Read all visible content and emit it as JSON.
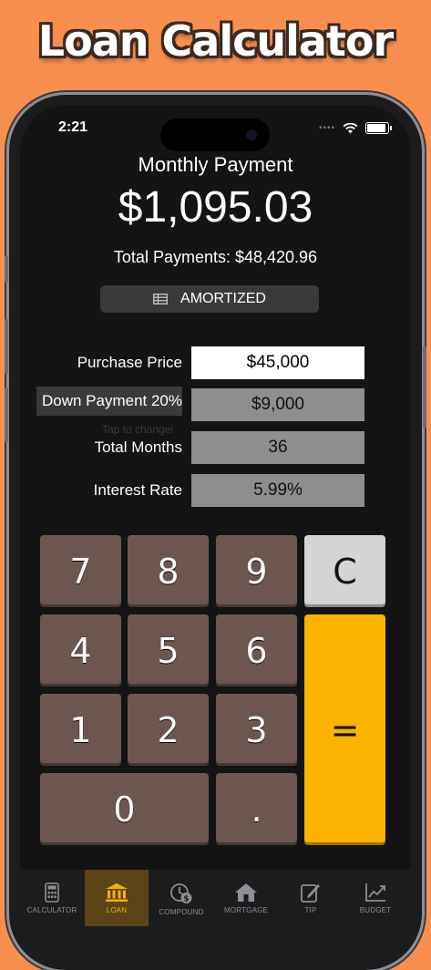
{
  "banner": {
    "title": "Loan Calculator"
  },
  "status": {
    "time": "2:21",
    "signal_dots": "••••"
  },
  "result": {
    "label": "Monthly Payment",
    "value": "$1,095.03",
    "total": "Total Payments: $48,420.96"
  },
  "amortized_button": {
    "label": "AMORTIZED"
  },
  "fields": [
    {
      "label": "Purchase Price",
      "value": "$45,000"
    },
    {
      "label": "Down Payment 20%",
      "value": "$9,000"
    },
    {
      "label": "Total Months",
      "value": "36"
    },
    {
      "label": "Interest Rate",
      "value": "5.99%"
    }
  ],
  "hint": "Tap to change!",
  "keypad": {
    "k7": "7",
    "k8": "8",
    "k9": "9",
    "clear": "C",
    "k4": "4",
    "k5": "5",
    "k6": "6",
    "k1": "1",
    "k2": "2",
    "k3": "3",
    "equals": "=",
    "k0": "0",
    "dot": "."
  },
  "tabs": [
    {
      "label": "CALCULATOR",
      "icon": "calculator-icon"
    },
    {
      "label": "LOAN",
      "icon": "bank-icon"
    },
    {
      "label": "COMPOUND",
      "icon": "compound-icon"
    },
    {
      "label": "MORTGAGE",
      "icon": "house-icon"
    },
    {
      "label": "TIP",
      "icon": "edit-icon"
    },
    {
      "label": "BUDGET",
      "icon": "chart-icon"
    }
  ],
  "colors": {
    "background": "#f98f4f",
    "number_key": "#6e5650",
    "equals_key": "#fbb300",
    "clear_key": "#d4d4d4",
    "active_tab": "#f5b100"
  }
}
